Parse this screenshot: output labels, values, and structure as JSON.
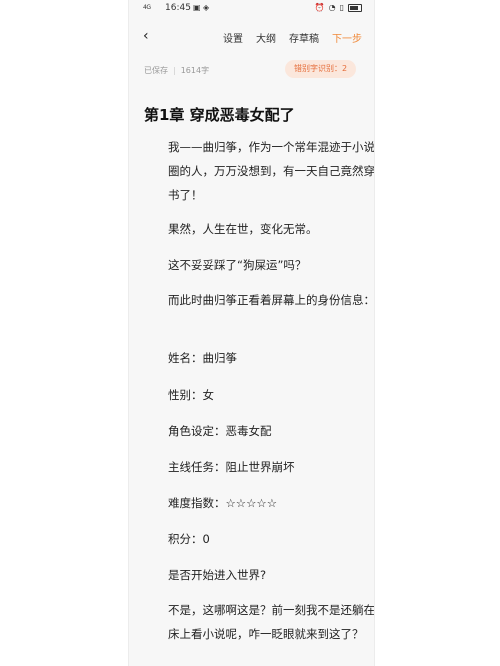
{
  "status_bar": {
    "signal": "4G",
    "time": "16:45",
    "battery_pct": "92"
  },
  "toolbar": {
    "back_label": "‹",
    "settings": "设置",
    "outline": "大纲",
    "drafts": "存草稿",
    "next": "下一步"
  },
  "meta": {
    "saved": "已保存",
    "word_count": "1614字",
    "typo_badge": "错别字识别：2"
  },
  "chapter": {
    "title": "第1章 穿成恶毒女配了",
    "paragraphs": [
      "我——曲归筝，作为一个常年混迹于小说圈的人，万万没想到，有一天自己竟然穿书了！",
      "果然，人生在世，变化无常。",
      "这不妥妥踩了“狗屎运”吗？",
      "而此时曲归筝正看着屏幕上的身份信息：",
      "姓名：曲归筝",
      "性别：女",
      "角色设定：恶毒女配",
      "主线任务：阻止世界崩坏",
      "难度指数：☆☆☆☆☆",
      "积分：0",
      "是否开始进入世界?",
      "不是，这哪啊这是？前一刻我不是还躺在床上看小说呢，咋一眨眼就来到这了？"
    ]
  },
  "colors": {
    "accent": "#f08a3a",
    "badge_bg": "#fbe7dc",
    "badge_text": "#e56d3a"
  }
}
